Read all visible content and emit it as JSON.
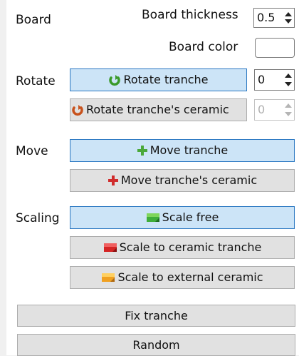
{
  "board": {
    "section_label": "Board",
    "thickness_label": "Board thickness",
    "thickness_value": "0.5",
    "color_label": "Board color",
    "color_value": "#ffffff"
  },
  "rotate": {
    "section_label": "Rotate",
    "rotate_tranche_label": "Rotate tranche",
    "rotate_tranche_value": "0",
    "rotate_ceramic_label": "Rotate tranche's ceramic",
    "rotate_ceramic_value": "0"
  },
  "move": {
    "section_label": "Move",
    "move_tranche_label": "Move tranche",
    "move_ceramic_label": "Move tranche's ceramic"
  },
  "scaling": {
    "section_label": "Scaling",
    "scale_free_label": "Scale free",
    "scale_ceramic_label": "Scale to ceramic tranche",
    "scale_external_label": "Scale to external ceramic"
  },
  "actions": {
    "fix_label": "Fix tranche",
    "random_label": "Random"
  },
  "icons": {
    "rotate_tranche": "rotate-green-icon",
    "rotate_ceramic": "rotate-orange-icon",
    "move_tranche": "move-green-icon",
    "move_ceramic": "move-red-icon",
    "scale_free": "scale-green-icon",
    "scale_ceramic": "scale-red-icon",
    "scale_external": "scale-orange-icon"
  },
  "colors": {
    "selected_fill": "#cce4f7",
    "selected_border": "#2b78c2",
    "button_fill": "#e1e1e1"
  }
}
